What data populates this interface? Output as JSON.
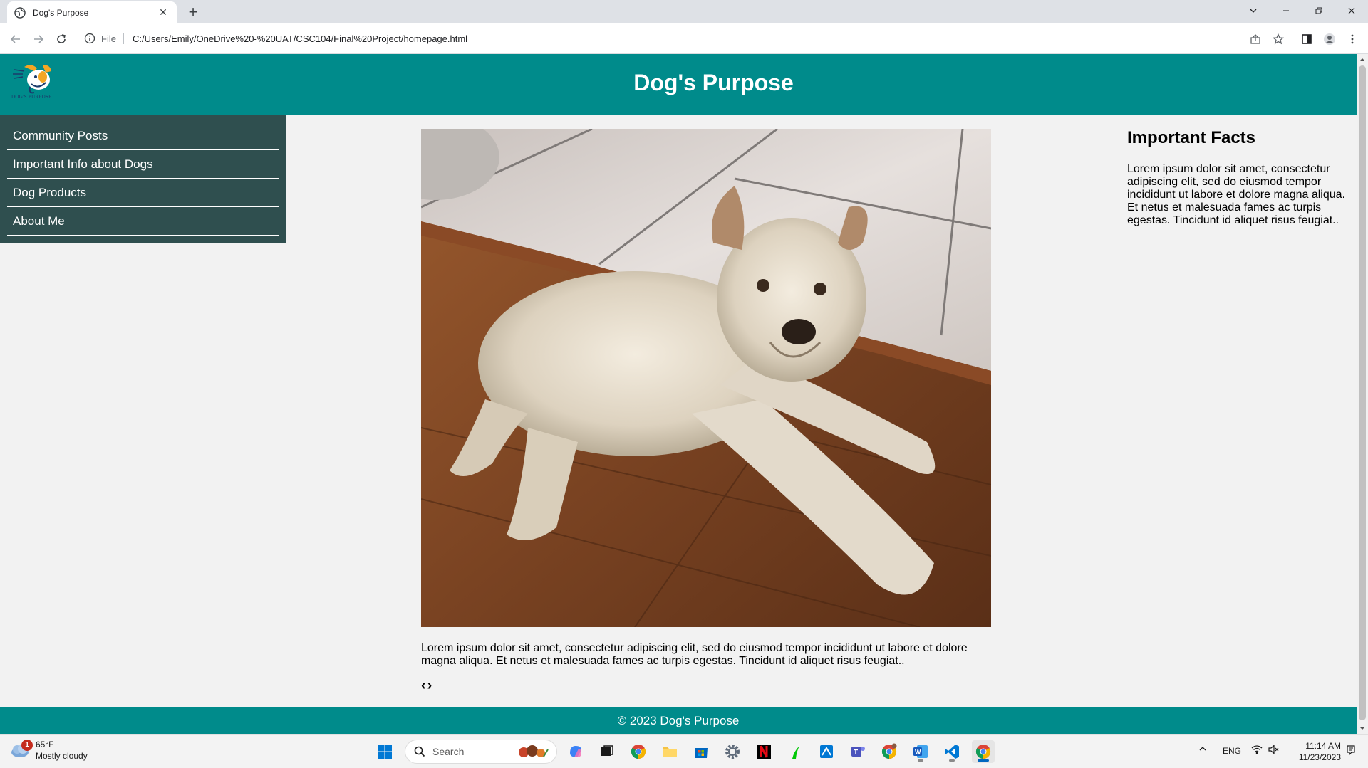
{
  "browser": {
    "tab_title": "Dog's Purpose",
    "address_scheme": "File",
    "address_url": "C:/Users/Emily/OneDrive%20-%20UAT/CSC104/Final%20Project/homepage.html"
  },
  "header": {
    "logo_text": "DOG'S PURPOSE",
    "title": "Dog's Purpose"
  },
  "sidebar": {
    "items": [
      {
        "label": "Community Posts"
      },
      {
        "label": "Important Info about Dogs"
      },
      {
        "label": "Dog Products"
      },
      {
        "label": "About Me"
      }
    ]
  },
  "main": {
    "image_subject": "white terrier dog lying on wooden floor",
    "paragraph": "Lorem ipsum dolor sit amet, consectetur adipiscing elit, sed do eiusmod tempor incididunt ut labore et dolore magna aliqua. Et netus et malesuada fames ac turpis egestas. Tincidunt id aliquet risus feugiat..",
    "prev_arrow": "‹",
    "next_arrow": "›"
  },
  "aside": {
    "heading": "Important Facts",
    "paragraph": "Lorem ipsum dolor sit amet, consectetur adipiscing elit, sed do eiusmod tempor incididunt ut labore et dolore magna aliqua. Et netus et malesuada fames ac turpis egestas. Tincidunt id aliquet risus feugiat.."
  },
  "footer": {
    "text": "© 2023 Dog's Purpose"
  },
  "taskbar": {
    "weather_temp": "65°F",
    "weather_desc": "Mostly cloudy",
    "weather_badge": "1",
    "search_placeholder": "Search",
    "tray_lang": "ENG",
    "time": "11:14 AM",
    "date": "11/23/2023"
  },
  "colors": {
    "header_bg": "#008b8b",
    "sidebar_bg": "#2f4f4f",
    "page_bg": "#f2f2f2"
  },
  "icons": [
    "globe-icon",
    "close-icon",
    "plus-icon",
    "back-icon",
    "forward-icon",
    "reload-icon",
    "info-icon",
    "share-icon",
    "star-icon",
    "sidepanel-icon",
    "profile-icon",
    "menu-icon",
    "windows-icon",
    "search-icon",
    "chrome-icon",
    "folder-icon",
    "vscode-icon",
    "word-icon",
    "teams-icon",
    "netflix-icon",
    "wifi-icon",
    "speaker-icon",
    "notification-icon"
  ]
}
